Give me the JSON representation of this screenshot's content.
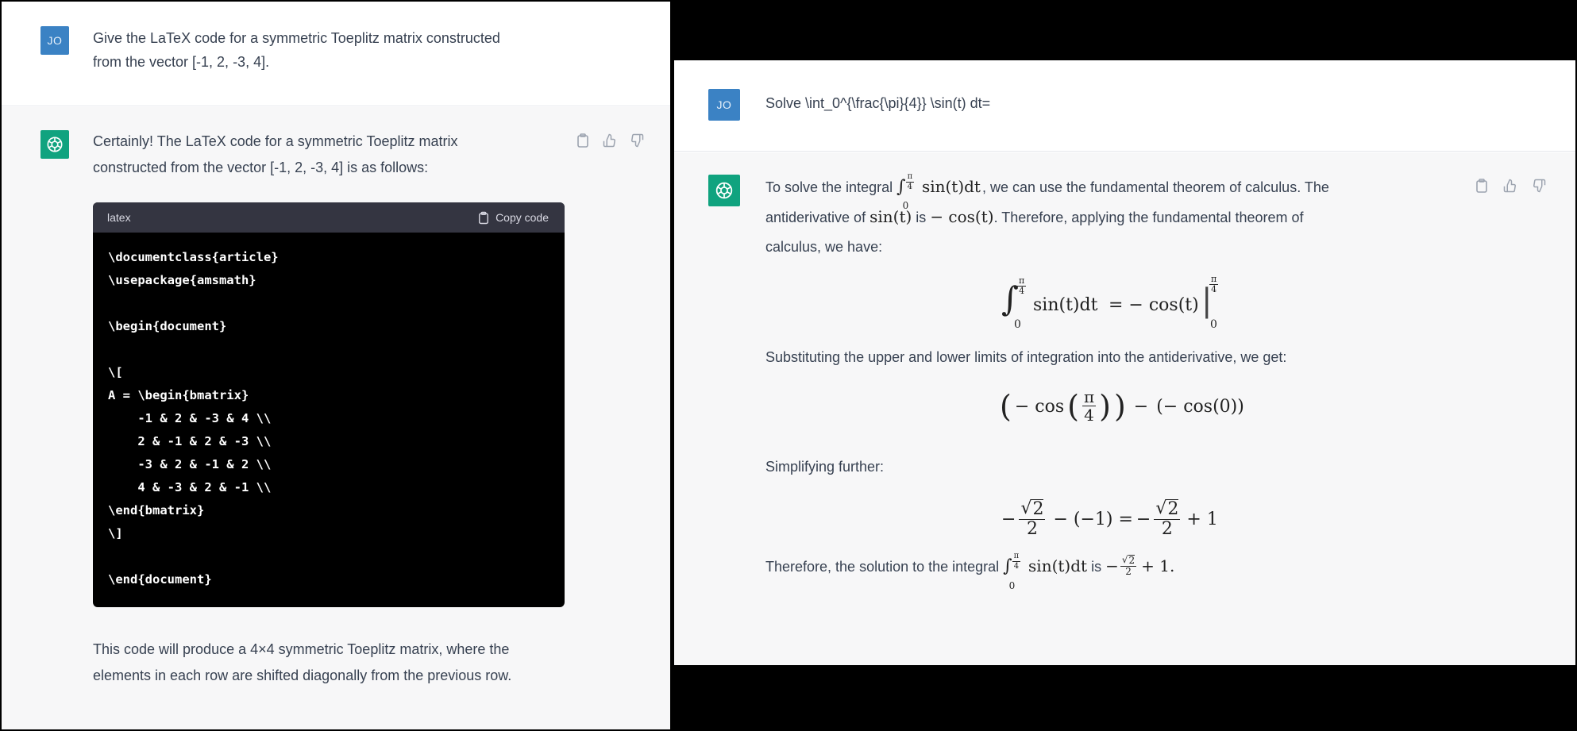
{
  "left": {
    "user": {
      "avatar": "JO",
      "lines": [
        "Give the LaTeX code for a symmetric Toeplitz matrix constructed",
        "from the vector [-1, 2, -3, 4]."
      ]
    },
    "assistant": {
      "intro_lines": [
        "Certainly! The LaTeX code for a symmetric Toeplitz matrix",
        "constructed from the vector [-1, 2, -3, 4] is as follows:"
      ],
      "code_lang": "latex",
      "copy_label": "Copy code",
      "code_lines": [
        "\\documentclass{article}",
        "\\usepackage{amsmath}",
        "",
        "\\begin{document}",
        "",
        "\\[",
        "A = \\begin{bmatrix}",
        "    -1 & 2 & -3 & 4 \\\\",
        "    2 & -1 & 2 & -3 \\\\",
        "    -3 & 2 & -1 & 2 \\\\",
        "    4 & -3 & 2 & -1 \\\\",
        "\\end{bmatrix}",
        "\\]",
        "",
        "\\end{document}"
      ],
      "outro_lines": [
        "This code will produce a 4×4 symmetric Toeplitz matrix, where the",
        "elements in each row are shifted diagonally from the previous row."
      ]
    }
  },
  "right": {
    "user": {
      "avatar": "JO",
      "text": "Solve \\int_0^{\\frac{\\pi}{4}} \\sin(t) dt="
    },
    "assistant": {
      "p1_a": "To solve the integral",
      "p1_b": ", we can use the fundamental theorem of calculus. The",
      "p1_c": "antiderivative of",
      "p1_d": "is",
      "p1_e": ". Therefore, applying the fundamental theorem of",
      "p1_f": "calculus, we have:",
      "p2": "Substituting the upper and lower limits of integration into the antiderivative, we get:",
      "p3": "Simplifying further:",
      "p4_a": "Therefore, the solution to the integral",
      "p4_b": "is",
      "math": {
        "int_sign": "∫",
        "lower": "0",
        "pi": "π",
        "four": "4",
        "integrand": "sin(t)dt",
        "sin_t": "sin(t)",
        "neg_cos_t": "− cos(t)",
        "eq_rhs": "= − cos(t)",
        "bar_sep": "|",
        "cos_open": "− cos",
        "paren_open": "(",
        "paren_close": ")",
        "minus_mid": "−",
        "cos_zero": "(− cos(0))",
        "sqrt2": "2",
        "neg": "−",
        "minus_neg1": "− (−1) =",
        "plus_one": "+ 1",
        "plus_one_dot": "+ 1."
      }
    }
  },
  "colors": {
    "user_avatar": "#3b82c4",
    "assistant_avatar": "#10a37f",
    "assistant_bg": "#f7f7f8",
    "code_header_bg": "#343541",
    "code_bg": "#000000"
  },
  "icons": [
    "openai-logo-icon",
    "clipboard-icon",
    "thumbs-up-icon",
    "thumbs-down-icon"
  ]
}
